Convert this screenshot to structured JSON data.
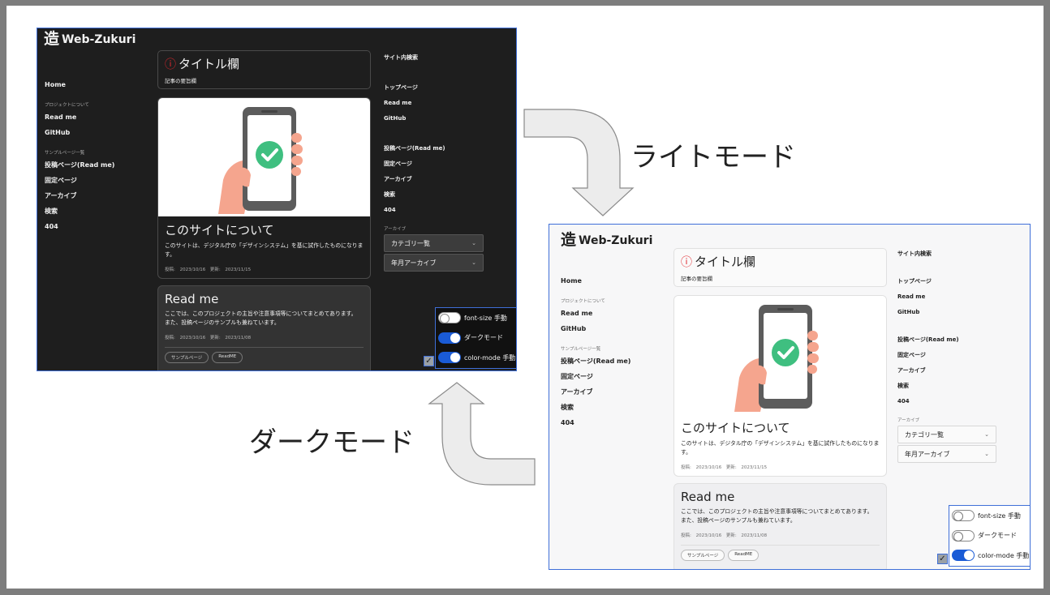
{
  "labels": {
    "light_mode": "ライトモード",
    "dark_mode": "ダークモード"
  },
  "site": {
    "logo_mark": "造",
    "logo_text": "Web-Zukuri",
    "nav": {
      "home": "Home",
      "project_heading": "プロジェクトについて",
      "read_me": "Read me",
      "github": "GitHub",
      "sample_heading": "サンプルページ一覧",
      "post_page": "投稿ページ(Read me)",
      "fixed_page": "固定ページ",
      "archive": "アーカイブ",
      "search": "検索",
      "not_found": "404"
    },
    "title_card": {
      "title": "タイトル欄",
      "summary": "記事の要旨欄"
    },
    "article": {
      "title": "このサイトについて",
      "text": "このサイトは、デジタル庁の「デザインシステム」を基に試作したものになります。",
      "posted": "投稿: 2023/10/16",
      "updated": "更新: 2023/11/15"
    },
    "readme_card": {
      "title": "Read me",
      "text": "ここでは、このプロジェクトの主旨や注意事項等についてまとめてあります。 また、投稿ページのサンプルも兼ねています。",
      "posted": "投稿: 2023/10/16",
      "updated": "更新: 2023/11/08",
      "tags": [
        "サンプルページ",
        "ReadME"
      ]
    },
    "side": {
      "site_search": "サイト内検索",
      "top_page": "トップページ",
      "read_me": "Read me",
      "github": "GitHub",
      "post_page": "投稿ページ(Read me)",
      "fixed_page": "固定ページ",
      "archive": "アーカイブ",
      "search": "検索",
      "not_found": "404",
      "archive_heading": "アーカイブ",
      "category_select": "カテゴリ一覧",
      "monthly_select": "年月アーカイブ"
    },
    "toggles": {
      "font_size": "font-size 手動",
      "dark_mode": "ダークモード",
      "color_mode": "color-mode 手動"
    }
  },
  "states": {
    "dark": {
      "font_size_on": false,
      "dark_mode_on": true,
      "color_mode_on": true
    },
    "light": {
      "font_size_on": false,
      "dark_mode_on": false,
      "color_mode_on": true
    }
  },
  "colors": {
    "accent": "#1a5bd6",
    "warning": "#e0282e",
    "frame_border": "#3f6fd8",
    "dark_bg": "#1e1e1e",
    "light_bg": "#f7f7f8"
  }
}
